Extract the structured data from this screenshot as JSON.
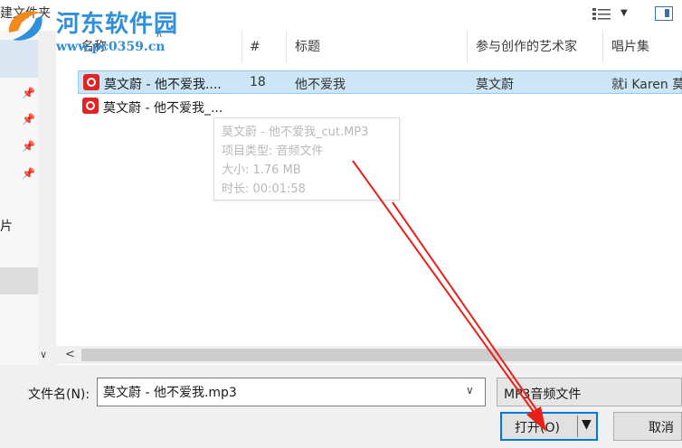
{
  "window": {
    "title_fragment": "建文件夹"
  },
  "watermark": {
    "title": "河东软件园",
    "url": "www.pc0359.cn"
  },
  "left_nav": {
    "fragment_text": "片"
  },
  "columns": [
    {
      "label": "名称"
    },
    {
      "label": "#"
    },
    {
      "label": "标题"
    },
    {
      "label": "参与创作的艺术家"
    },
    {
      "label": "唱片集"
    }
  ],
  "files": [
    {
      "name": "莫文蔚 - 他不爱我....",
      "number": "18",
      "title": "他不爱我",
      "artist": "莫文蔚",
      "album": "就i Karen 莫",
      "selected": true,
      "icon": "netease-music-icon"
    },
    {
      "name": "莫文蔚 - 他不爱我_...",
      "number": "",
      "title": "",
      "artist": "",
      "album": "",
      "selected": false,
      "icon": "netease-music-icon"
    }
  ],
  "tooltip": {
    "lines": [
      "莫文蔚 - 他不爱我_cut.MP3",
      "项目类型: 音频文件",
      "大小: 1.76 MB",
      "时长: 00:01:58"
    ]
  },
  "footer": {
    "filename_label": "文件名(N):",
    "filename_value": "莫文蔚 - 他不爱我.mp3",
    "filetype_value": "MP3音频文件",
    "open_label": "打开(O)",
    "cancel_label": "取消"
  },
  "colors": {
    "selection": "#cce5f7",
    "accent": "#0078d7",
    "annotation": "#e8201a",
    "watermark": "#2f8fd8"
  }
}
